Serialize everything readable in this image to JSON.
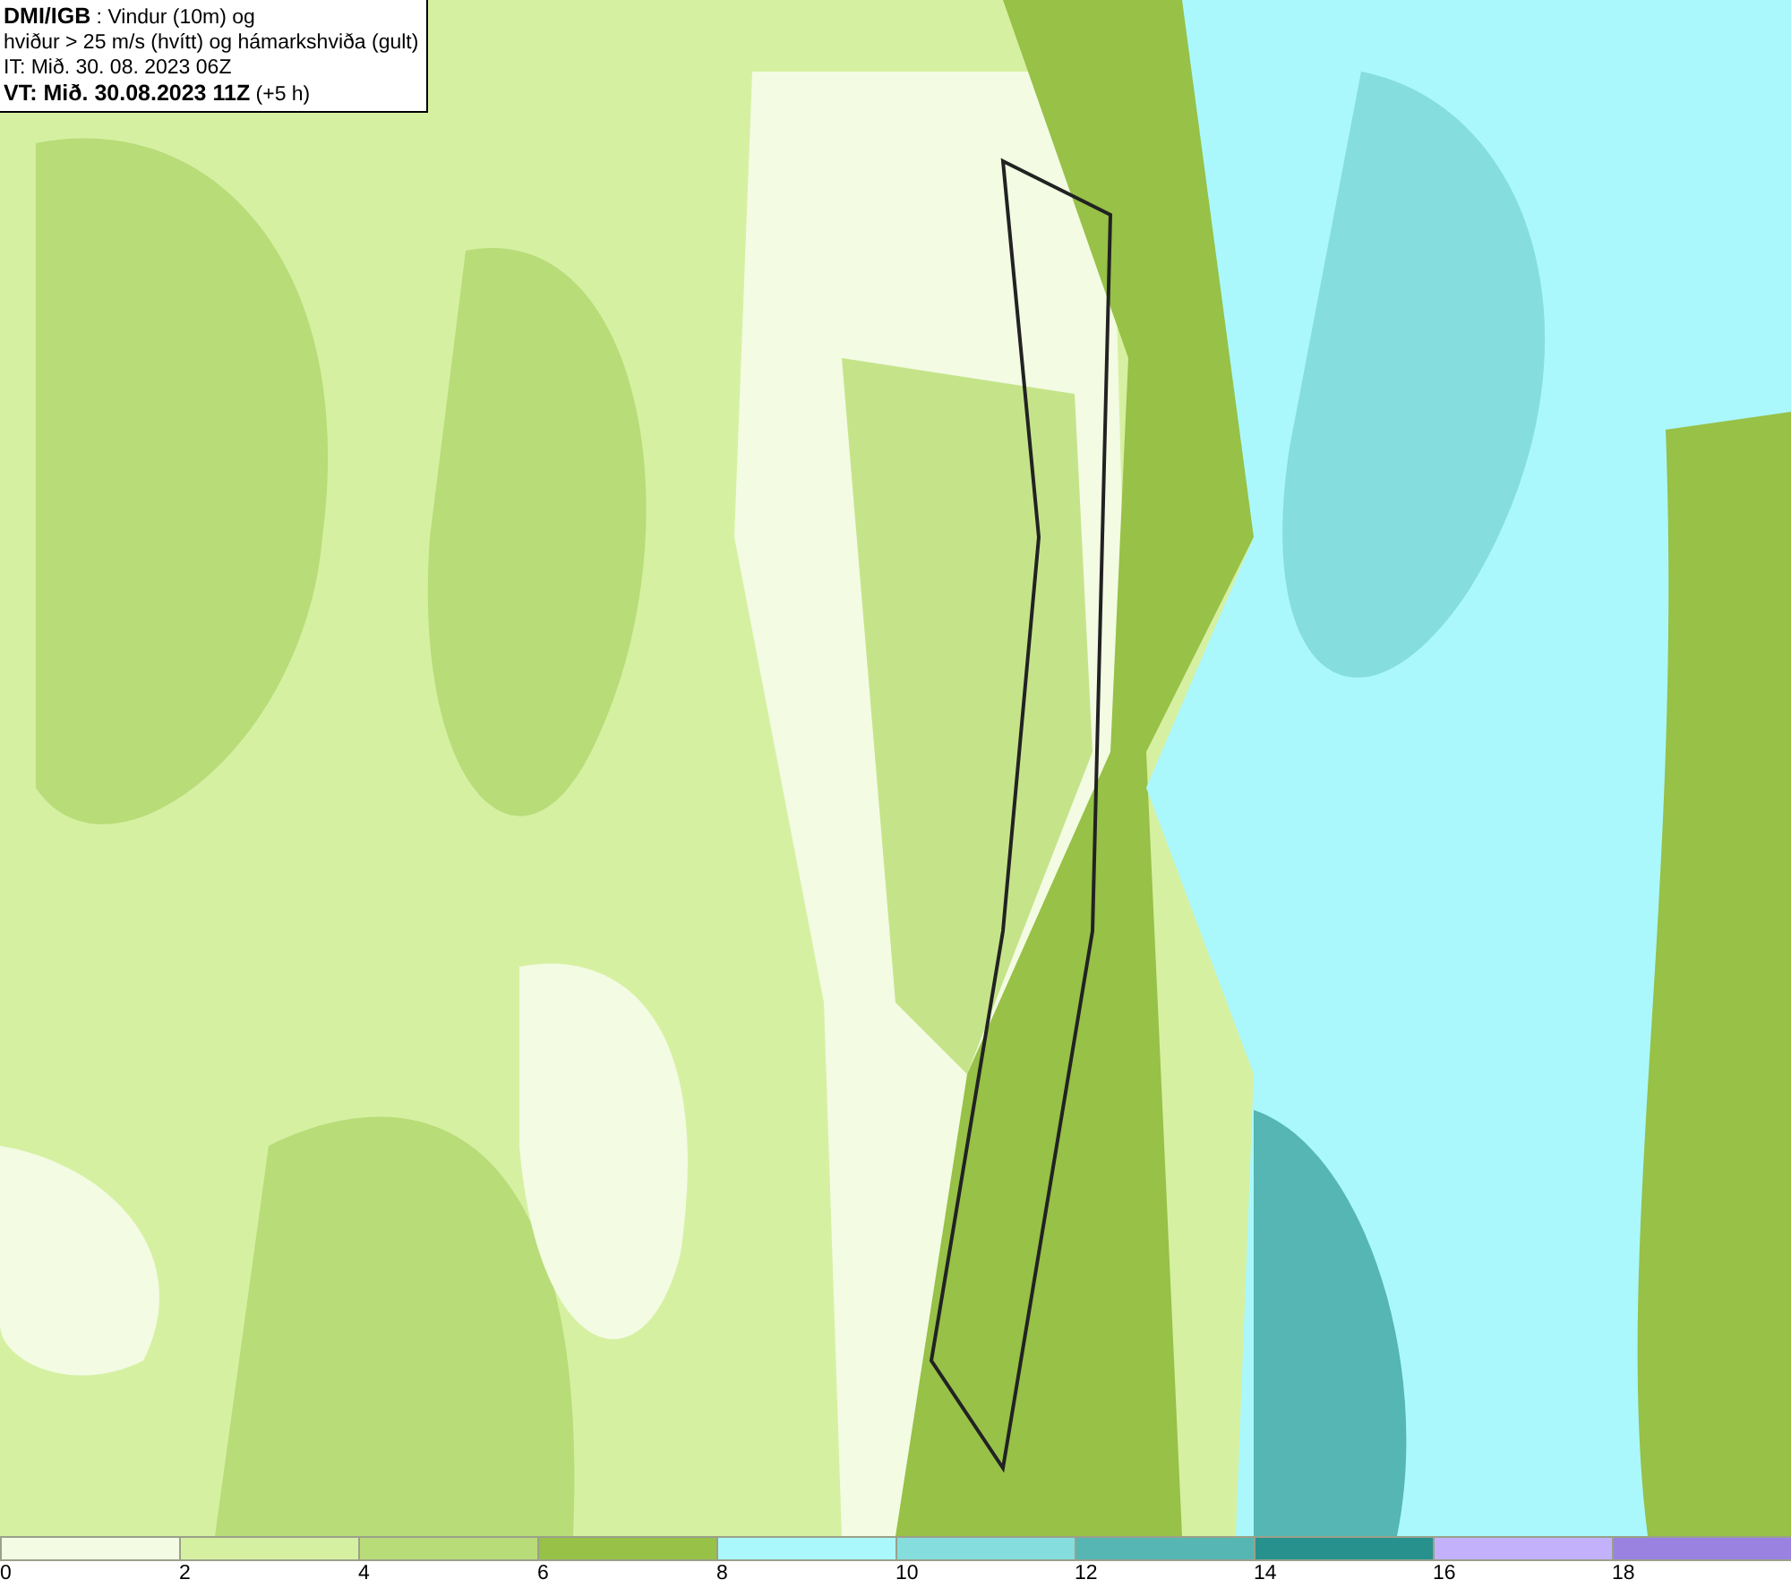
{
  "header": [
    "**DMI/IGB** : Vindur (10m) og",
    "hviður > 25 m/s (hvítt) og hámarkshviða (gult)",
    "IT: Mið. 30. 08. 2023 06Z",
    "**VT: Mið. 30.08.2023 11Z** (+5 h)"
  ],
  "legend": [
    {
      "label": "0",
      "color": "#f3fbe3"
    },
    {
      "label": "2",
      "color": "#d6f0a2"
    },
    {
      "label": "4",
      "color": "#b8dc78"
    },
    {
      "label": "6",
      "color": "#97c147"
    },
    {
      "label": "8",
      "color": "#aaf8fc"
    },
    {
      "label": "10",
      "color": "#85dddd"
    },
    {
      "label": "12",
      "color": "#55b6b3"
    },
    {
      "label": "14",
      "color": "#26918d"
    },
    {
      "label": "16",
      "color": "#c3b2fb"
    },
    {
      "label": "18",
      "color": "#9982e0"
    }
  ]
}
